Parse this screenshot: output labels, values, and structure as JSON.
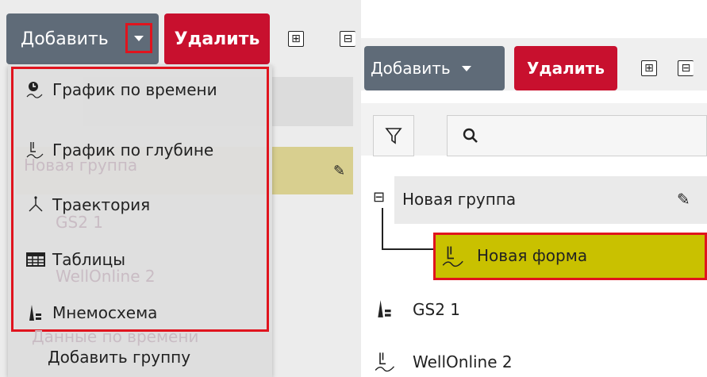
{
  "left": {
    "toolbar": {
      "add_label": "Добавить",
      "delete_label": "Удалить",
      "expand_symbol": "⊞",
      "collapse_symbol": "⊟"
    },
    "menu": {
      "items": [
        {
          "label": "График по времени",
          "icon": "time-chart-icon"
        },
        {
          "label": "График по глубине",
          "icon": "depth-chart-icon"
        },
        {
          "label": "Траектория",
          "icon": "trajectory-icon"
        },
        {
          "label": "Таблицы",
          "icon": "table-icon"
        },
        {
          "label": "Мнемосхема",
          "icon": "mnemoscheme-icon"
        }
      ],
      "extra_items": [
        {
          "label": "Данные по времени"
        },
        {
          "label": "Добавить группу"
        }
      ]
    },
    "background_tree": {
      "group": "Новая группа",
      "item1": "GS2 1",
      "item2": "WellOnline 2"
    }
  },
  "right": {
    "toolbar": {
      "add_label": "Добавить",
      "delete_label": "Удалить",
      "expand_symbol": "⊞",
      "collapse_symbol": "⊟"
    },
    "tree": {
      "group": {
        "label": "Новая группа",
        "toggle": "⊟"
      },
      "new_form": {
        "label": "Новая форма"
      },
      "items": [
        {
          "label": "GS2 1"
        },
        {
          "label": "WellOnline 2"
        }
      ]
    }
  },
  "colors": {
    "delete": "#c8102e",
    "add": "#5f6b78",
    "highlight": "#c9c100",
    "annotation": "#e0141e"
  }
}
